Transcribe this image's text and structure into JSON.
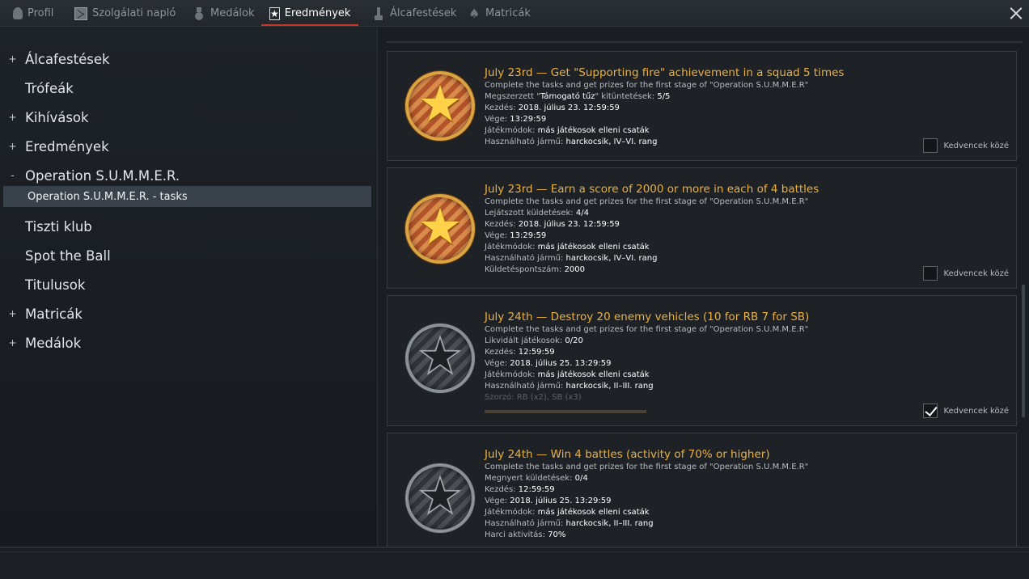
{
  "tabs": [
    {
      "label": "Profil",
      "icon": "profile-icon"
    },
    {
      "label": "Szolgálati napló",
      "icon": "diary-icon"
    },
    {
      "label": "Medálok",
      "icon": "medal-icon"
    },
    {
      "label": "Eredmények",
      "icon": "star-icon",
      "active": true
    },
    {
      "label": "Álcafestések",
      "icon": "brush-icon"
    },
    {
      "label": "Matricák",
      "icon": "decal-icon"
    }
  ],
  "sidebar": {
    "items": [
      {
        "prefix": "+",
        "label": "Álcafestések"
      },
      {
        "prefix": "",
        "label": "Trófeák"
      },
      {
        "prefix": "+",
        "label": "Kihívások"
      },
      {
        "prefix": "+",
        "label": "Eredmények"
      },
      {
        "prefix": "-",
        "label": "Operation S.U.M.M.E.R."
      },
      {
        "prefix": "",
        "label": "Operation S.U.M.M.E.R. - tasks",
        "selected": true
      },
      {
        "prefix": "",
        "label": "Tiszti klub"
      },
      {
        "prefix": "",
        "label": "Spot the Ball"
      },
      {
        "prefix": "",
        "label": "Titulusok"
      },
      {
        "prefix": "+",
        "label": "Matricák"
      },
      {
        "prefix": "+",
        "label": "Medálok"
      }
    ]
  },
  "cards": [
    {
      "badge": "gold",
      "title": "July 23rd — Get \"Supporting fire\" achievement in a squad 5 times",
      "description": "Complete the tasks and get prizes for the first stage of \"Operation S.U.M.M.E.R\"",
      "lines": [
        {
          "label": "Megszerzett \"",
          "value": "Támogató tűz",
          "suffix": "\" kitüntetések: ",
          "value2": "5/5"
        },
        {
          "label": "Kezdés: ",
          "value": "2018. július 23. 12:59:59"
        },
        {
          "label": "Vége: ",
          "value": "13:29:59"
        },
        {
          "label": "Játékmódok: ",
          "value": "más játékosok elleni csaták"
        },
        {
          "label": "Használható jármű: ",
          "value": "harckocsik, IV–VI. rang"
        }
      ],
      "favorite_label": "Kedvencek közé",
      "favorite": false
    },
    {
      "badge": "gold",
      "title": "July 23rd — Earn a score of 2000 or more in each of 4 battles",
      "description": "Complete the tasks and get prizes for the first stage of \"Operation S.U.M.M.E.R\"",
      "lines": [
        {
          "label": "Lejátszott küldetések: ",
          "value": "4/4"
        },
        {
          "label": "Kezdés: ",
          "value": "2018. július 23. 12:59:59"
        },
        {
          "label": "Vége: ",
          "value": "13:29:59"
        },
        {
          "label": "Játékmódok: ",
          "value": "más játékosok elleni csaták"
        },
        {
          "label": "Használható jármű: ",
          "value": "harckocsik, IV–VI. rang"
        },
        {
          "label": "Küldetéspontszám: ",
          "value": "2000"
        }
      ],
      "favorite_label": "Kedvencek közé",
      "favorite": false
    },
    {
      "badge": "gray",
      "title": "July 24th — Destroy 20 enemy vehicles (10 for RB 7 for SB)",
      "description": "Complete the tasks and get prizes for the first stage of \"Operation S.U.M.M.E.R\"",
      "lines": [
        {
          "label": "Likvidált játékosok: ",
          "value": "0/20"
        },
        {
          "label": "Kezdés: ",
          "value": "12:59:59"
        },
        {
          "label": "Vége: ",
          "value": "2018. július 25. 13:29:59"
        },
        {
          "label": "Játékmódok: ",
          "value": "más játékosok elleni csaták"
        },
        {
          "label": "Használható jármű: ",
          "value": "harckocsik, II–III. rang"
        }
      ],
      "dim_line": "Szorzó: RB (x2), SB (x3)",
      "progress": 0,
      "favorite_label": "Kedvencek közé",
      "favorite": true
    },
    {
      "badge": "gray",
      "title": "July 24th — Win 4 battles (activity of 70% or higher)",
      "description": "Complete the tasks and get prizes for the first stage of \"Operation S.U.M.M.E.R\"",
      "lines": [
        {
          "label": "Megnyert küldetések: ",
          "value": "0/4"
        },
        {
          "label": "Kezdés: ",
          "value": "12:59:59"
        },
        {
          "label": "Vége: ",
          "value": "2018. július 25. 13:29:59"
        },
        {
          "label": "Játékmódok: ",
          "value": "más játékosok elleni csaták"
        },
        {
          "label": "Használható jármű: ",
          "value": "harckocsik, II–III. rang"
        },
        {
          "label": "Harci aktivitás: ",
          "value": "70%"
        }
      ]
    }
  ],
  "colors": {
    "accent_title": "#e9b143",
    "tab_active_underline": "#c0392b",
    "background": "#1a1e23"
  }
}
